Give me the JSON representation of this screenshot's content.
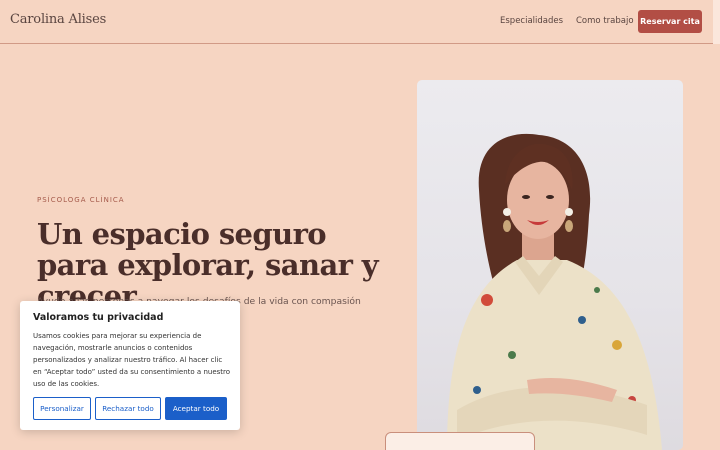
{
  "header": {
    "brand": "Carolina Alises",
    "nav": [
      "Especialidades",
      "Como trabajo"
    ],
    "cta": "Reservar cita"
  },
  "hero": {
    "eyebrow": "PSÍCOLOGA CLÍNICA",
    "headline": "Un espacio seguro para explorar, sanar y crecer",
    "lead": "Ayudo a las personas a navegar los desafíos de la vida con compasión y ... mentos, trabajaremos hacia un"
  },
  "photo": {
    "alt_icon": "portrait-photo",
    "colors": {
      "background": "#e8e6ea",
      "hair": "#5a2f22",
      "skin": "#e7b5a0",
      "shirt": "#ece1c8",
      "lips": "#c63a3a"
    }
  },
  "cookies": {
    "title": "Valoramos tu privacidad",
    "text": "Usamos cookies para mejorar su experiencia de navegación, mostrarle anuncios o contenidos personalizados y analizar nuestro tráfico. Al hacer clic en “Aceptar todo” usted da su consentimiento a nuestro uso de las cookies.",
    "customize": "Personalizar",
    "reject": "Rechazar todo",
    "accept": "Aceptar todo"
  },
  "colors": {
    "page_bg": "#f6d5c2",
    "accent": "#b24e45",
    "cookie_blue": "#1b5fc9"
  }
}
